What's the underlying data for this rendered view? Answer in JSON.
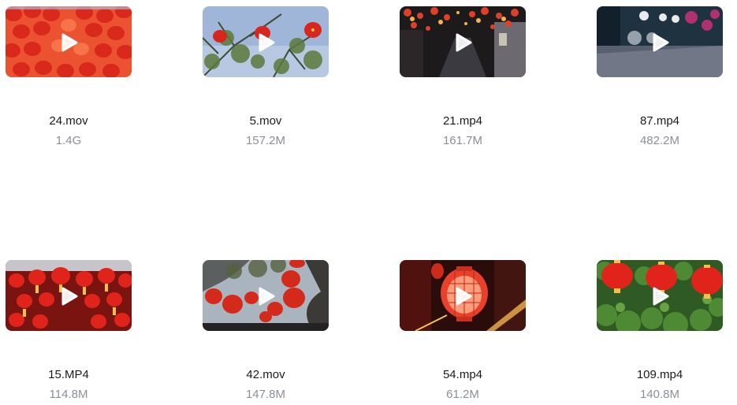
{
  "videos": [
    {
      "name": "24.mov",
      "size": "1.4G",
      "thumb": "red-lanterns-crowd-thumbnail"
    },
    {
      "name": "5.mov",
      "size": "157.2M",
      "thumb": "tree-lanterns-sky-thumbnail"
    },
    {
      "name": "21.mp4",
      "size": "161.7M",
      "thumb": "night-alley-lanterns-thumbnail"
    },
    {
      "name": "87.mp4",
      "size": "482.2M",
      "thumb": "blurred-night-street-thumbnail"
    },
    {
      "name": "15.MP4",
      "size": "114.8M",
      "thumb": "lantern-stall-decorations-thumbnail"
    },
    {
      "name": "42.mov",
      "size": "147.8M",
      "thumb": "lanterns-under-tree-thumbnail"
    },
    {
      "name": "54.mp4",
      "size": "61.2M",
      "thumb": "glowing-lantern-closeup-thumbnail"
    },
    {
      "name": "109.mp4",
      "size": "140.8M",
      "thumb": "lanterns-green-leaves-thumbnail"
    }
  ],
  "icons": {
    "play": "play-icon"
  },
  "colors": {
    "lantern_red": "#e0241b",
    "play_overlay": "#ffffff",
    "size_text": "#8a8f98"
  }
}
